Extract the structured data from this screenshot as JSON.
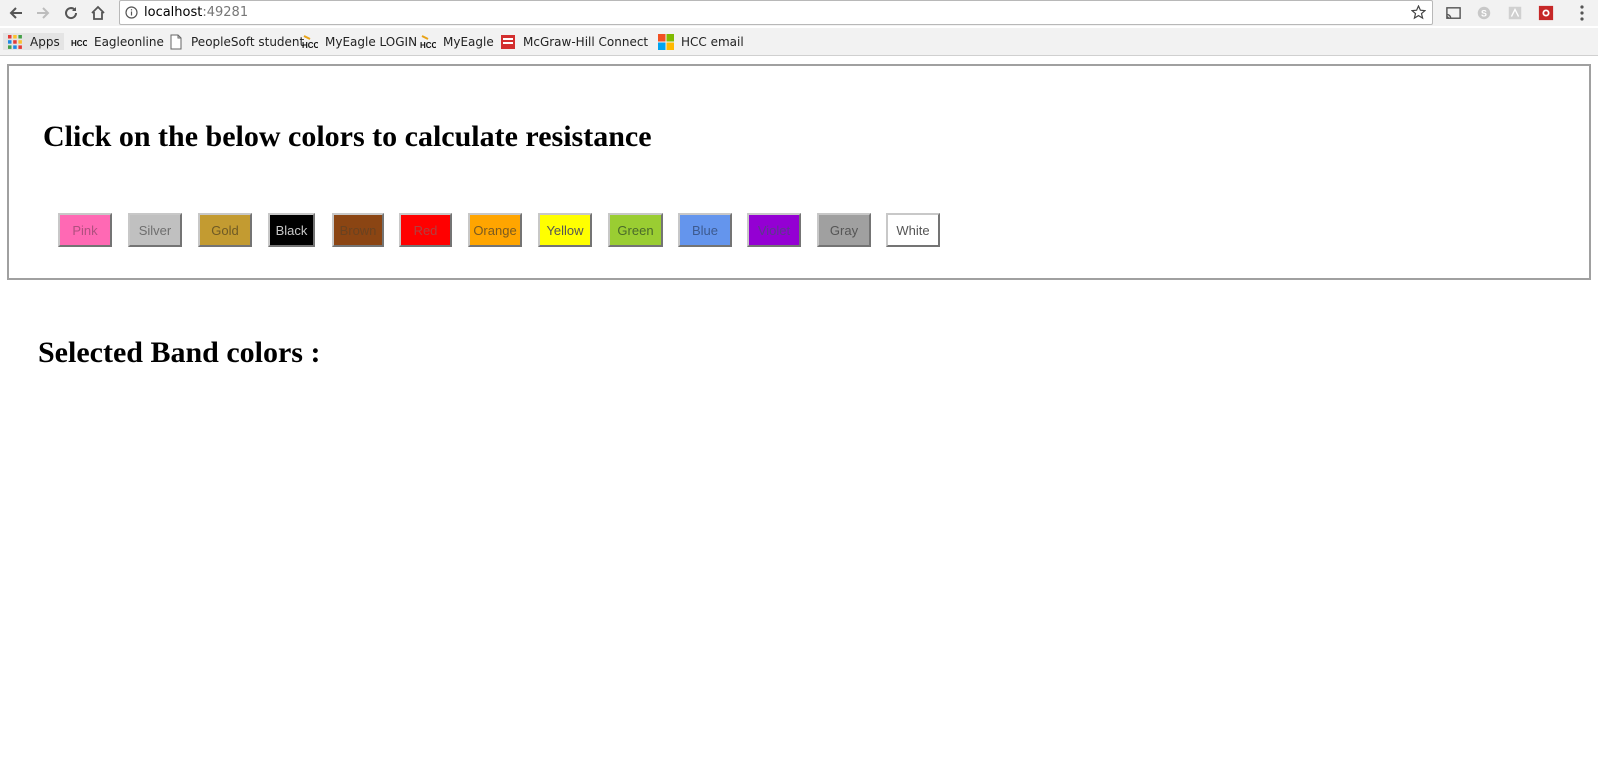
{
  "browser": {
    "url_host": "localhost",
    "url_port": ":49281",
    "bookmarks": [
      {
        "label": "Apps",
        "icon": "apps-grid-icon"
      },
      {
        "label": "Eagleonline",
        "icon": "hcc-logo-icon"
      },
      {
        "label": "PeopleSoft student",
        "icon": "page-icon"
      },
      {
        "label": "MyEagle LOGIN",
        "icon": "hcc-logo-icon"
      },
      {
        "label": "MyEagle",
        "icon": "hcc-logo-icon"
      },
      {
        "label": "McGraw-Hill Connect",
        "icon": "mcgraw-hill-icon"
      },
      {
        "label": "HCC email",
        "icon": "microsoft-logo-icon"
      }
    ]
  },
  "page": {
    "heading": "Click on the below colors to calculate resistance",
    "selected_label": "Selected Band colors :",
    "color_buttons": [
      {
        "label": "Pink",
        "bg": "#ff69b4",
        "fg": "#b0507f"
      },
      {
        "label": "Silver",
        "bg": "#c0c0c0",
        "fg": "#6e6e6e"
      },
      {
        "label": "Gold",
        "bg": "#c39b31",
        "fg": "#6f5a25"
      },
      {
        "label": "Black",
        "bg": "#000000",
        "fg": "#c8c8c8"
      },
      {
        "label": "Brown",
        "bg": "#8b4513",
        "fg": "#6a4220"
      },
      {
        "label": "Red",
        "bg": "#ff0000",
        "fg": "#b04040"
      },
      {
        "label": "Orange",
        "bg": "#ffa500",
        "fg": "#7a5a20"
      },
      {
        "label": "Yellow",
        "bg": "#ffff00",
        "fg": "#555555"
      },
      {
        "label": "Green",
        "bg": "#9acd32",
        "fg": "#4a6a2a"
      },
      {
        "label": "Blue",
        "bg": "#6495ed",
        "fg": "#3d5a8f"
      },
      {
        "label": "Violet",
        "bg": "#9400d3",
        "fg": "#5a3a8a"
      },
      {
        "label": "Gray",
        "bg": "#a0a0a0",
        "fg": "#555555"
      },
      {
        "label": "White",
        "bg": "#ffffff",
        "fg": "#555555"
      }
    ]
  }
}
